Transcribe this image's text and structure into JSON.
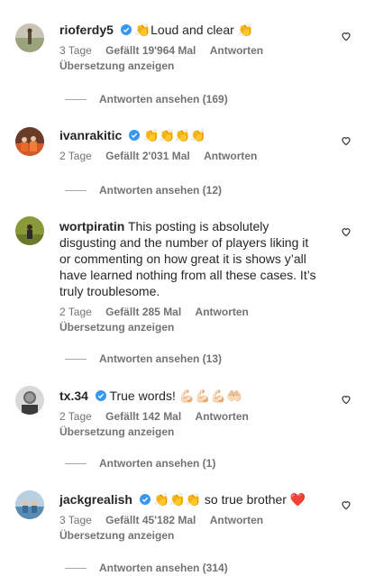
{
  "comments": [
    {
      "username": "rioferdy5",
      "verified": true,
      "text": "👏Loud and clear 👏",
      "time": "3 Tage",
      "likes": "Gefällt 19'964 Mal",
      "reply": "Antworten",
      "translate": "Übersetzung anzeigen",
      "view_replies": "Antworten ansehen (169)"
    },
    {
      "username": "ivanrakitic",
      "verified": true,
      "text": "👏👏👏👏",
      "time": "2 Tage",
      "likes": "Gefällt 2'031 Mal",
      "reply": "Antworten",
      "view_replies": "Antworten ansehen (12)"
    },
    {
      "username": "wortpiratin",
      "verified": false,
      "text": "This posting is absolutely disgusting and the number of players liking it or commenting on how great it is shows y’all have learned nothing from all these cases. It’s truly troublesome.",
      "time": "2 Tage",
      "likes": "Gefällt 285 Mal",
      "reply": "Antworten",
      "translate": "Übersetzung anzeigen",
      "view_replies": "Antworten ansehen (13)"
    },
    {
      "username": "tx.34",
      "verified": true,
      "text": "True words! 💪🏻💪🏻💪🏻🤲🏻",
      "time": "2 Tage",
      "likes": "Gefällt 142 Mal",
      "reply": "Antworten",
      "translate": "Übersetzung anzeigen",
      "view_replies": "Antworten ansehen (1)"
    },
    {
      "username": "jackgrealish",
      "verified": true,
      "text": "👏👏👏 so true brother ❤️",
      "time": "3 Tage",
      "likes": "Gefällt 45'182 Mal",
      "reply": "Antworten",
      "translate": "Übersetzung anzeigen",
      "view_replies": "Antworten ansehen (314)"
    }
  ],
  "colors": {
    "verified": "#3897f0",
    "secondary_text": "#737373",
    "heart_love": "#ed4956"
  },
  "icons": {
    "heart": "heart-outline-icon",
    "verified": "verified-badge-icon"
  }
}
